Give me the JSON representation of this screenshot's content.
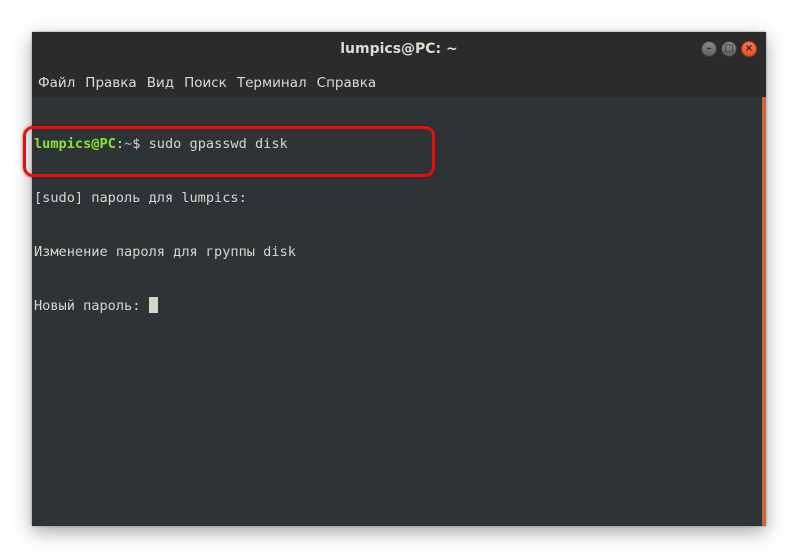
{
  "window": {
    "title": "lumpics@PC: ~",
    "buttons": {
      "minimize_glyph": "–",
      "maximize_glyph": "□",
      "close_glyph": "×"
    }
  },
  "menu": {
    "items": [
      "Файл",
      "Правка",
      "Вид",
      "Поиск",
      "Терминал",
      "Справка"
    ]
  },
  "terminal": {
    "prompt_user": "lumpics@PC",
    "prompt_colon": ":",
    "prompt_path": "~",
    "prompt_symbol": "$ ",
    "command": "sudo gpasswd disk",
    "lines": [
      "[sudo] пароль для lumpics:",
      "Изменение пароля для группы disk",
      "Новый пароль: "
    ]
  },
  "colors": {
    "prompt_user": "#8ae234",
    "prompt_path": "#729fcf",
    "terminal_bg": "#2e3436",
    "highlight": "#e3100f",
    "scrollbar": "#c86a3c"
  }
}
